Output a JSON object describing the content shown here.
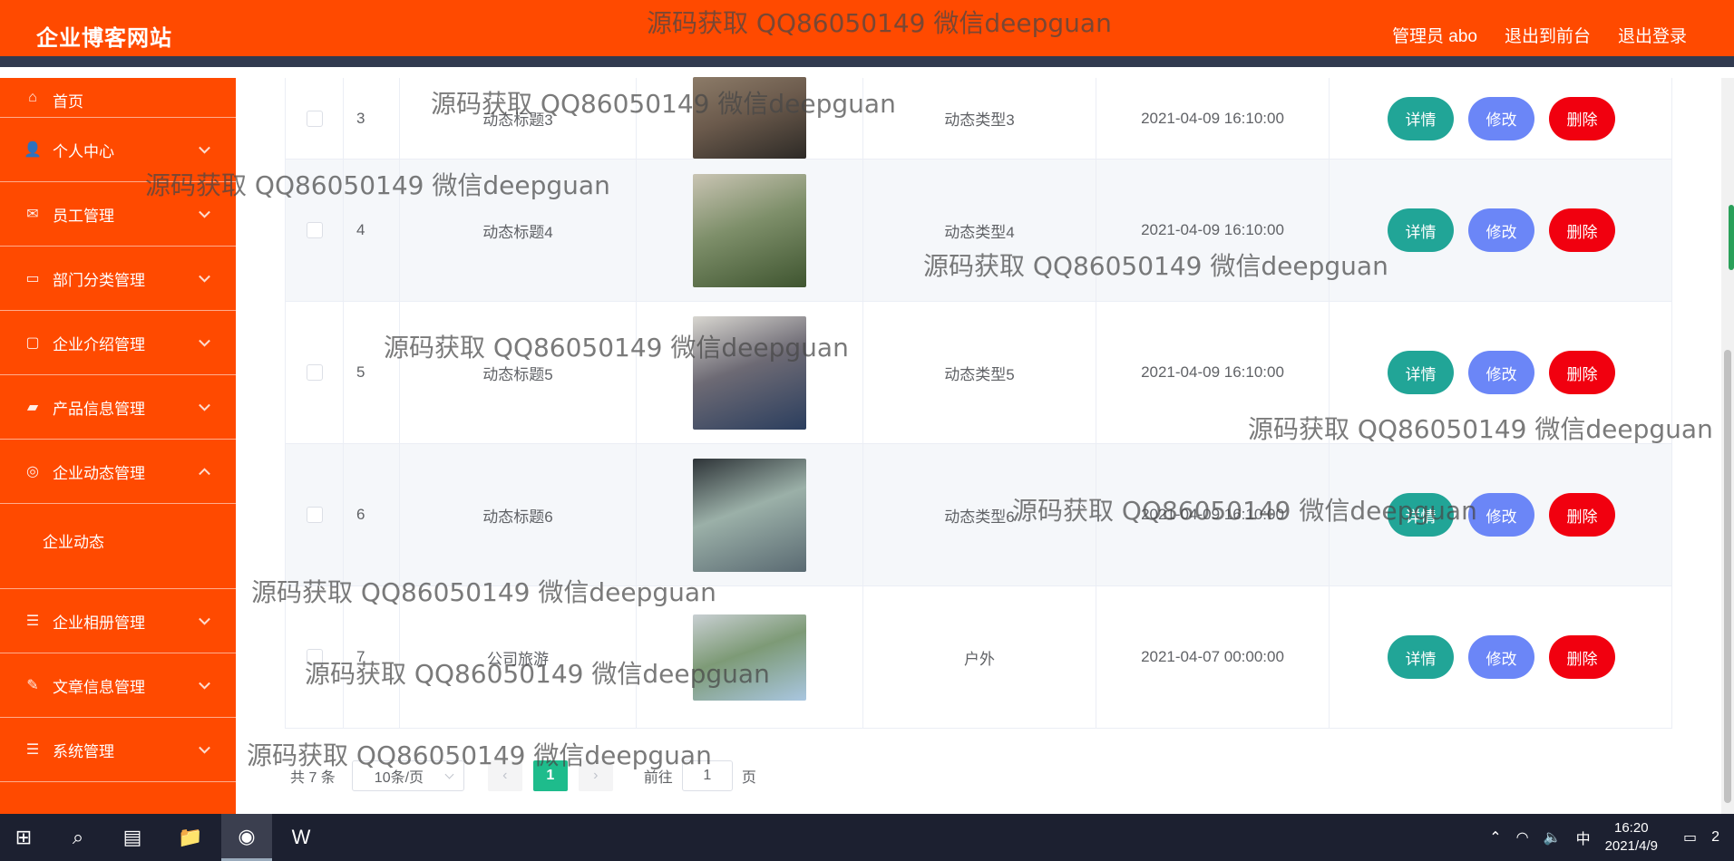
{
  "header": {
    "brand": "企业博客网站",
    "user": "管理员 abo",
    "back_front": "退出到前台",
    "logout": "退出登录"
  },
  "sidebar": {
    "items": [
      {
        "label": "首页",
        "icon": "home-icon"
      },
      {
        "label": "个人中心",
        "icon": "user-icon"
      },
      {
        "label": "员工管理",
        "icon": "mail-icon"
      },
      {
        "label": "部门分类管理",
        "icon": "card-icon"
      },
      {
        "label": "企业介绍管理",
        "icon": "chat-icon"
      },
      {
        "label": "产品信息管理",
        "icon": "wallet-icon"
      },
      {
        "label": "企业动态管理",
        "icon": "target-icon"
      },
      {
        "label": "企业相册管理",
        "icon": "list-icon"
      },
      {
        "label": "文章信息管理",
        "icon": "edit-icon"
      },
      {
        "label": "系统管理",
        "icon": "list-icon"
      }
    ],
    "sub_item": "企业动态"
  },
  "table": {
    "rows": [
      {
        "index": "3",
        "title": "动态标题3",
        "type": "动态类型3",
        "date": "2021-04-09 16:10:00",
        "img_colors": [
          "#2d2a26",
          "#6b5a4c",
          "#8c7b68"
        ]
      },
      {
        "index": "4",
        "title": "动态标题4",
        "type": "动态类型4",
        "date": "2021-04-09 16:10:00",
        "img_colors": [
          "#3f5530",
          "#7e8f6a",
          "#c9c4b3"
        ]
      },
      {
        "index": "5",
        "title": "动态标题5",
        "type": "动态类型5",
        "date": "2021-04-09 16:10:00",
        "img_colors": [
          "#2b3e5e",
          "#6d6a74",
          "#d8d6d0"
        ]
      },
      {
        "index": "6",
        "title": "动态标题6",
        "type": "动态类型6",
        "date": "2021-04-09 16:10:00",
        "img_colors": [
          "#5a6a72",
          "#9bb0a8",
          "#2e3438"
        ]
      },
      {
        "index": "7",
        "title": "公司旅游",
        "type": "户外",
        "date": "2021-04-07 00:00:00",
        "img_colors": [
          "#a9c6e0",
          "#7d9a76",
          "#c8cfd2"
        ]
      }
    ],
    "actions": {
      "detail": "详情",
      "edit": "修改",
      "delete": "删除"
    }
  },
  "pagination": {
    "total": "共 7 条",
    "page_size": "10条/页",
    "current_page": "1",
    "goto_label": "前往",
    "goto_value": "1",
    "page_unit": "页",
    "prev": "‹",
    "next": "›"
  },
  "watermark": "源码获取 QQ86050149 微信deepguan",
  "taskbar": {
    "time": "16:20",
    "date": "2021/4/9",
    "ime": "中",
    "notify_count": "2"
  },
  "colors": {
    "primary": "#ff4a00",
    "header_border": "#313a4f",
    "detail_btn": "#21a597",
    "edit_btn": "#6b86f7",
    "delete_btn": "#f1000f",
    "page_active": "#1ebc8c"
  }
}
